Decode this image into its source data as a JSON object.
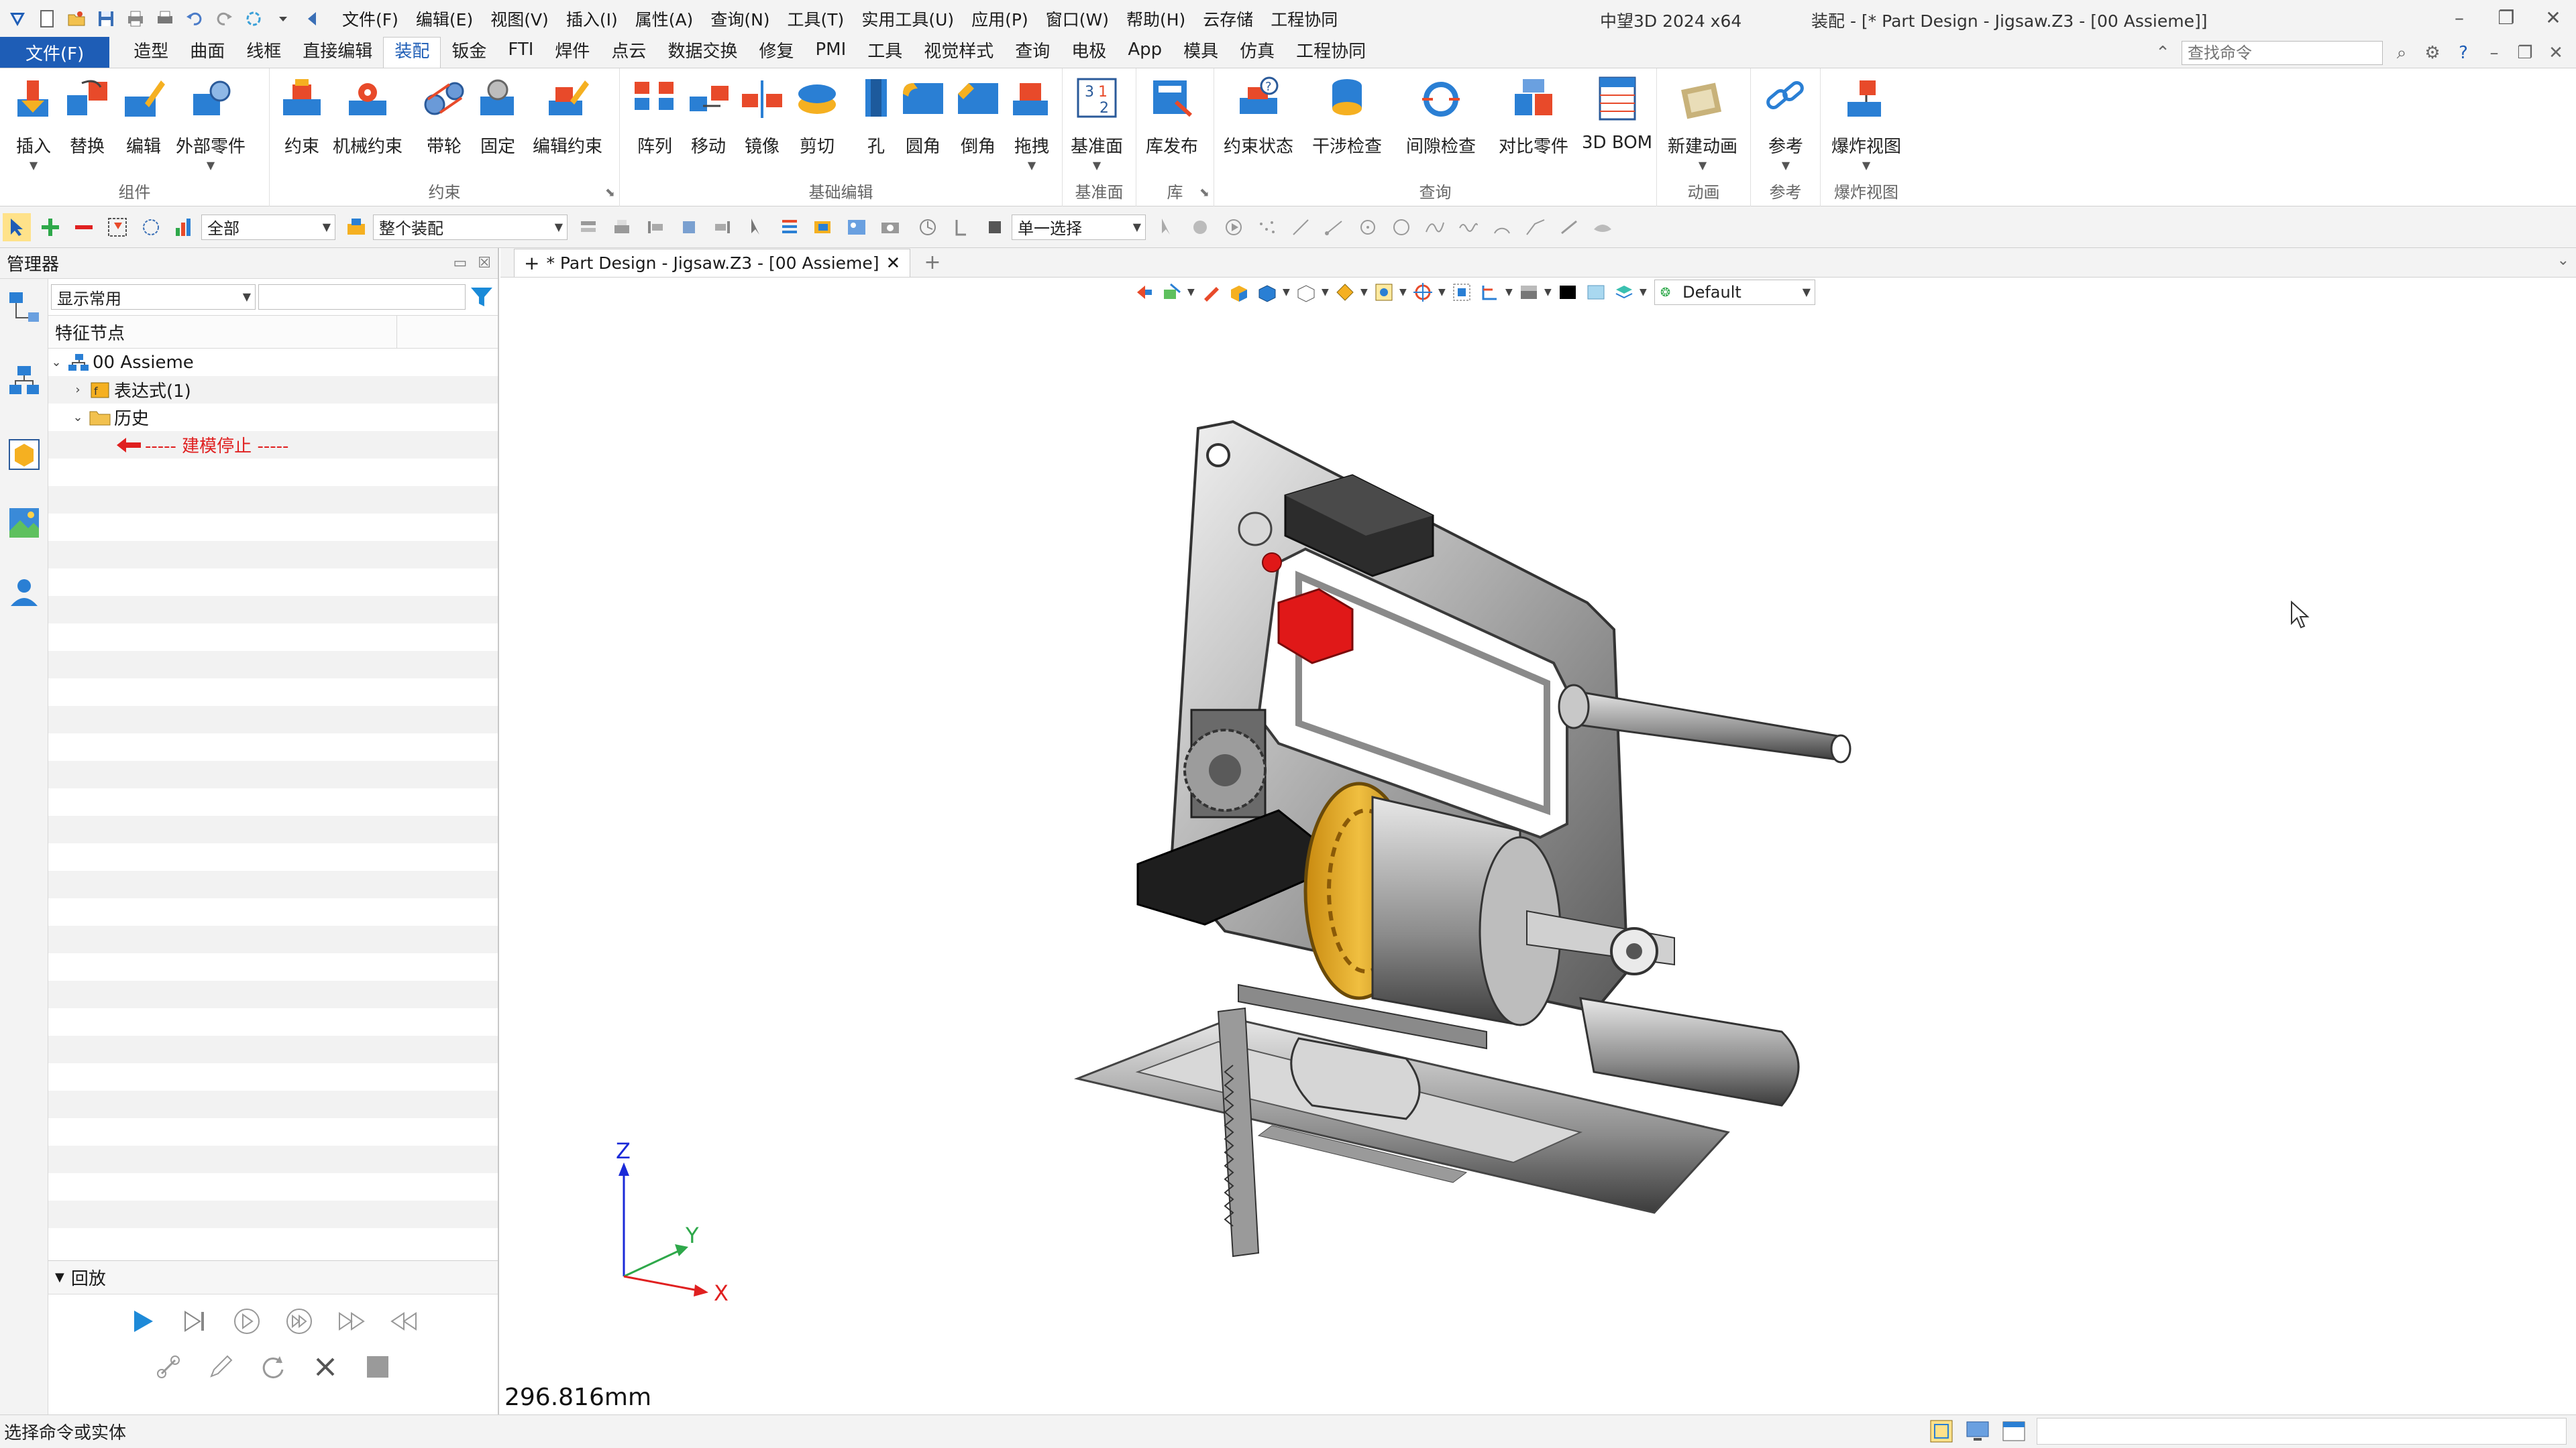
{
  "titlebar": {
    "menu": [
      "文件(F)",
      "编辑(E)",
      "视图(V)",
      "插入(I)",
      "属性(A)",
      "查询(N)",
      "工具(T)",
      "实用工具(U)",
      "应用(P)",
      "窗口(W)",
      "帮助(H)",
      "云存储",
      "工程协同"
    ],
    "app_name": "中望3D 2024 x64",
    "document": "装配 - [* Part Design - Jigsaw.Z3 - [00 Assieme]]"
  },
  "ribbon_tabs": {
    "file": "文件(F)",
    "tabs": [
      "造型",
      "曲面",
      "线框",
      "直接编辑",
      "装配",
      "钣金",
      "FTI",
      "焊件",
      "点云",
      "数据交换",
      "修复",
      "PMI",
      "工具",
      "视觉样式",
      "查询",
      "电极",
      "App",
      "模具",
      "仿真",
      "工程协同"
    ],
    "active": "装配",
    "search_placeholder": "查找命令"
  },
  "ribbon": {
    "groups": {
      "component": "组件",
      "constraint": "约束",
      "basic_edit": "基础编辑",
      "datum": "基准面",
      "library": "库",
      "query": "查询",
      "animation": "动画",
      "reference": "参考",
      "explode": "爆炸视图"
    },
    "buttons": {
      "insert": "插入",
      "replace": "替换",
      "edit": "编辑",
      "external_part": "外部零件",
      "constrain": "约束",
      "mech_constrain": "机械约束",
      "belt": "带轮",
      "fix": "固定",
      "edit_constrain": "编辑约束",
      "pattern": "阵列",
      "move": "移动",
      "mirror": "镜像",
      "cut": "剪切",
      "hole": "孔",
      "fillet": "圆角",
      "chamfer": "倒角",
      "drag": "拖拽",
      "datum_plane": "基准面",
      "lib_publish": "库发布",
      "constraint_status": "约束状态",
      "interference": "干涉检查",
      "clearance": "间隙检查",
      "compare": "对比零件",
      "bom3d": "3D BOM",
      "new_anim": "新建动画",
      "ref": "参考",
      "explode_view": "爆炸视图"
    }
  },
  "toolbar2": {
    "filter": "全部",
    "scope": "整个装配",
    "select_mode": "单一选择"
  },
  "manager": {
    "title": "管理器",
    "display_filter": "显示常用",
    "column_header": "特征节点",
    "tree": [
      {
        "label": "00 Assieme"
      },
      {
        "label": "表达式(1)"
      },
      {
        "label": "历史"
      },
      {
        "label": "----- 建模停止 -----"
      }
    ],
    "playback_title": "回放"
  },
  "doc_tab": {
    "label": "* Part Design - Jigsaw.Z3 - [00 Assieme]"
  },
  "viewport": {
    "view_style": "Default",
    "scale_readout": "296.816mm",
    "axes": {
      "z": "Z",
      "y": "Y",
      "x": "X"
    }
  },
  "status": {
    "message": "选择命令或实体"
  },
  "colors": {
    "accent": "#1e5db6",
    "stop_marker": "#e02020"
  }
}
